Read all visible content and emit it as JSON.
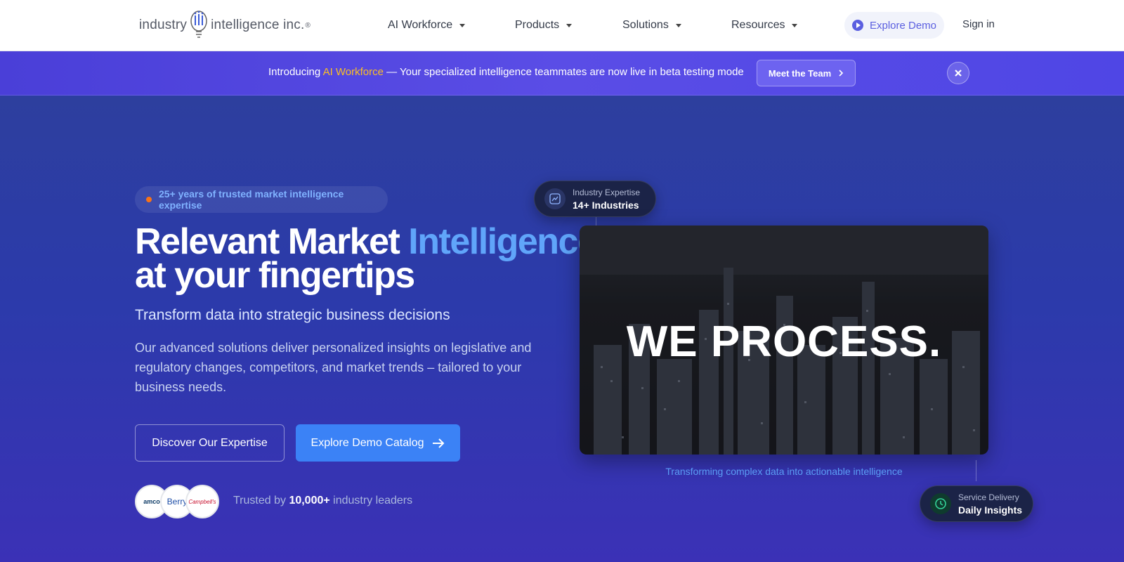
{
  "header": {
    "logo": {
      "left": "industry",
      "right": "intelligence inc.",
      "reg": "®"
    },
    "nav": [
      {
        "label": "AI Workforce"
      },
      {
        "label": "Products"
      },
      {
        "label": "Solutions"
      },
      {
        "label": "Resources"
      }
    ],
    "explore_demo": "Explore Demo",
    "sign_in": "Sign in"
  },
  "announcement": {
    "intro": "Introducing ",
    "highlight": "AI Workforce",
    "rest": " — Your specialized intelligence teammates are now live in beta testing mode",
    "button": "Meet the Team"
  },
  "hero": {
    "badge": "25+ years of trusted market intelligence expertise",
    "title_part1": "Relevant Market ",
    "title_accent": "Intelligence",
    "title_line2": "at your fingertips",
    "subhead": "Transform data into strategic business decisions",
    "paragraph": "Our advanced solutions deliver personalized insights on legislative and regulatory changes, competitors, and market trends – tailored to your business needs.",
    "btn_outline": "Discover Our Expertise",
    "btn_primary": "Explore Demo Catalog",
    "clients": [
      "amco",
      "Berry",
      "Campbell's"
    ],
    "trusted_prefix": "Trusted by ",
    "trusted_count": "10,000+",
    "trusted_suffix": " industry leaders"
  },
  "visual": {
    "pill_top": {
      "label": "Industry Expertise",
      "value": "14+ Industries"
    },
    "image_text": "WE PROCESS.",
    "caption": "Transforming complex data into actionable intelligence",
    "pill_bottom": {
      "label": "Service Delivery",
      "value": "Daily Insights"
    }
  },
  "colors": {
    "accent_blue": "#3b82f6",
    "highlight": "#fbbf24",
    "banner": "#4f46e5"
  }
}
